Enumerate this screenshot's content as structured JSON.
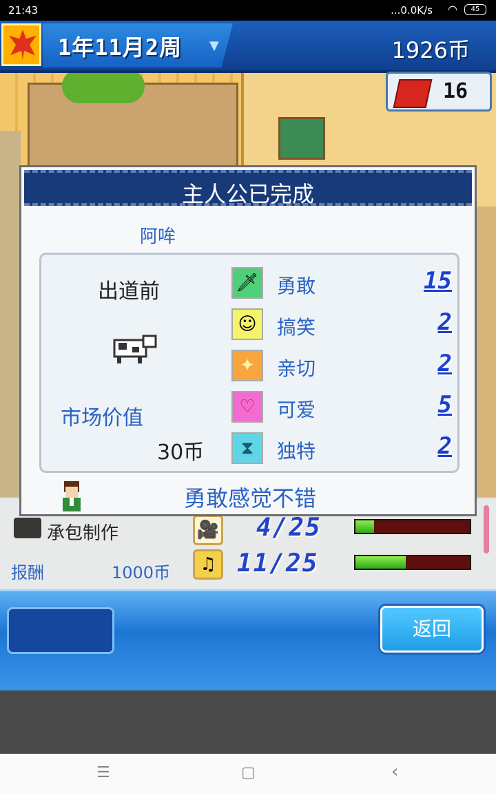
{
  "status_bar": {
    "time": "21:43",
    "network": "...0.0K/s",
    "battery": "45"
  },
  "header": {
    "date": "1年11月2周",
    "coins": "1926币",
    "fans_count": "16"
  },
  "dialog": {
    "title": "主人公已完成",
    "name": "阿哞",
    "stage": "出道前",
    "market_value_label": "市场价值",
    "market_value": "30币",
    "stats": [
      {
        "label": "勇敢",
        "value": "15",
        "icon": "sword-icon"
      },
      {
        "label": "搞笑",
        "value": "2",
        "icon": "smile-icon"
      },
      {
        "label": "亲切",
        "value": "2",
        "icon": "sparkle-icon"
      },
      {
        "label": "可爱",
        "value": "5",
        "icon": "heart-icon"
      },
      {
        "label": "独特",
        "value": "2",
        "icon": "hourglass-icon"
      }
    ],
    "comment": "勇敢感觉不错"
  },
  "project": {
    "type_label": "承包制作",
    "reward_label": "报酬",
    "reward_value": "1000币",
    "progress_1": "4/25",
    "progress_1_fraction": 0.16,
    "progress_2": "11/25",
    "progress_2_fraction": 0.44
  },
  "buttons": {
    "back": "返回"
  },
  "nav": {
    "menu": "☰",
    "home": "▢",
    "back": "‹"
  },
  "colors": {
    "accent_blue": "#2a62c4",
    "header_blue": "#183a78",
    "progress_green": "#2aa818"
  }
}
